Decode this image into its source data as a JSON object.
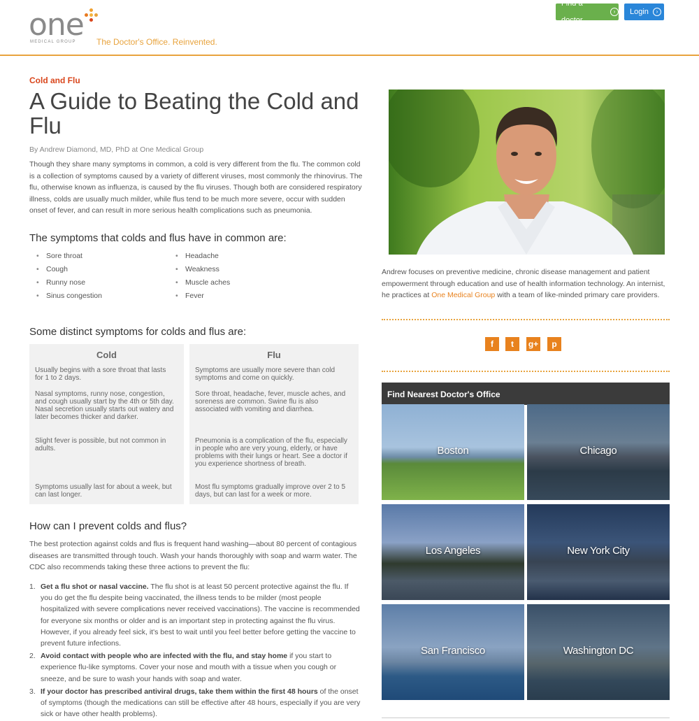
{
  "header": {
    "logo_word": "one",
    "logo_sub": "MEDICAL GROUP",
    "tagline": "The Doctor's Office. Reinvented.",
    "find_doctor_label": "Find a doctor",
    "login_label": "Login",
    "colors": {
      "accent": "#e8a33d",
      "green": "#6ab04c",
      "blue": "#2a86d9"
    }
  },
  "article": {
    "kicker": "Cold and Flu",
    "title": "A Guide to Beating the Cold and Flu",
    "byline": "By Andrew Diamond, MD, PhD at One Medical Group",
    "intro": "Though they share many symptoms in common, a cold is very different from the flu. The common cold is a collection of symptoms caused by a variety of different viruses, most commonly the rhinovirus. The flu, otherwise known as influenza, is caused by the flu viruses. Though both are considered respiratory illness, colds are usually much milder, while flus tend to be much more severe, occur with sudden onset of fever, and can result in more serious health complications such as pneumonia.",
    "common_heading": "The symptoms that colds and flus have in common are:",
    "common_left": [
      "Sore throat",
      "Cough",
      "Runny nose",
      "Sinus congestion"
    ],
    "common_right": [
      "Headache",
      "Weakness",
      "Muscle aches",
      "Fever"
    ],
    "distinct_heading": "Some distinct symptoms for colds and flus are:",
    "cold": {
      "title": "Cold",
      "items": [
        "Usually begins with a sore throat that lasts for 1 to 2 days.",
        "Nasal symptoms, runny nose, congestion, and cough usually start by the 4th or 5th day. Nasal secretion usually starts out watery and later becomes thicker and darker.",
        "Slight fever is possible, but not common in adults.",
        "Symptoms usually last for about a week, but can last longer."
      ]
    },
    "flu": {
      "title": "Flu",
      "items": [
        "Symptoms are usually more severe than cold symptoms and come on quickly.",
        "Sore throat, headache, fever, muscle aches, and soreness are common. Swine flu is also associated with vomiting and diarrhea.",
        "Pneumonia is a complication of the flu, especially in people who are very young, elderly, or have problems with their lungs or heart. See a doctor if you experience shortness of breath.",
        "Most flu symptoms gradually improve over 2 to 5 days, but can last for a week or more."
      ]
    },
    "prevent_heading": "How can I prevent colds and flus?",
    "prevent_intro": "The best protection against colds and flus is frequent hand washing—about 80 percent of contagious diseases are transmitted through touch. Wash your hands thoroughly with soap and warm water. The CDC also recommends taking these three actions to prevent the flu:",
    "prevent_items": [
      {
        "num": "1.",
        "bold": "Get a flu shot or nasal vaccine.",
        "text": " The flu shot is at least 50 percent protective against the flu. If you do get the flu despite being vaccinated, the illness tends to be milder (most people hospitalized with severe complications never received vaccinations). The vaccine is recommended for everyone six months or older and is an important step in protecting against the flu virus. However, if you already feel sick, it's best to wait until you feel better before getting the vaccine to prevent future infections."
      },
      {
        "num": "2.",
        "bold": "Avoid contact with people who are infected with the flu, and stay home",
        "text": " if you start to experience flu-like symptoms. Cover your nose and mouth with a tissue when you cough or sneeze, and be sure to wash your hands with soap and water."
      },
      {
        "num": "3.",
        "bold": "If your doctor has prescribed antiviral drugs, take them within the first 48 hours",
        "text": " of the onset of symptoms (though the medications can still be effective after 48 hours, especially if you are very sick or have other health problems)."
      }
    ]
  },
  "sidebar": {
    "bio_1": "Andrew focuses on preventive medicine, chronic disease management and patient empowerment through education and use of health information technology. An internist, he practices at ",
    "bio_link": "One Medical Group",
    "bio_2": " with a team of like-minded primary care providers.",
    "social": {
      "facebook": "f",
      "twitter": "t",
      "googleplus": "g+",
      "pinterest": "p"
    },
    "offices_heading": "Find Nearest Doctor's Office",
    "offices": [
      "Boston",
      "Chicago",
      "Los Angeles",
      "New York City",
      "San Francisco",
      "Washington DC"
    ]
  }
}
